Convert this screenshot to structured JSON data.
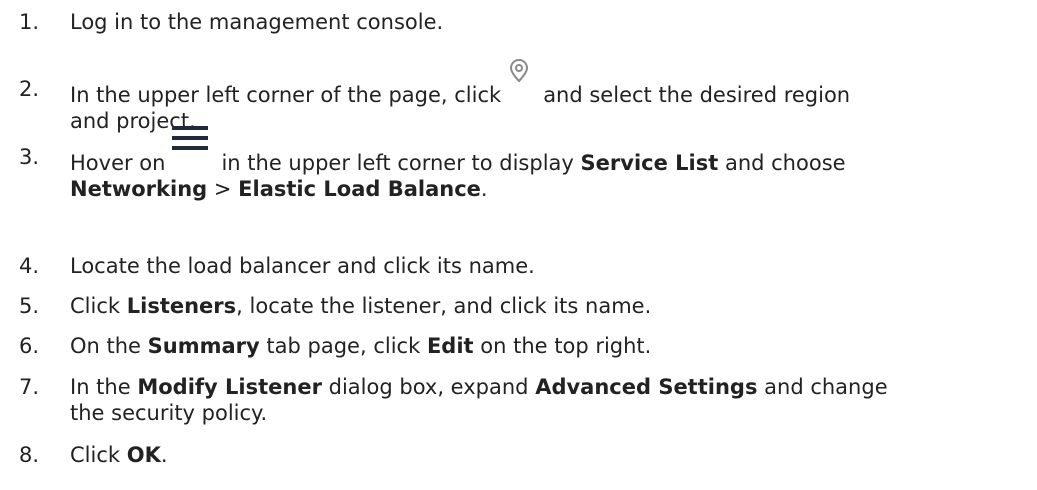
{
  "steps": [
    {
      "number": "1.",
      "text": "Log in to the management console."
    },
    {
      "number": "2.",
      "before_icon": "In the upper left corner of the page, click",
      "icon": "location-pin-icon",
      "after_icon": "and select the desired region",
      "continuation": "and project."
    },
    {
      "number": "3.",
      "before_icon": "Hover on",
      "icon": "hamburger-menu-icon",
      "after_icon": "in the upper left corner to display",
      "bold_1": "Service List",
      "after_bold_1": "and choose",
      "bold_2": "Networking",
      "separator": ">",
      "bold_3": "Elastic Load Balance",
      "end": "."
    },
    {
      "number": "4.",
      "text": "Locate the load balancer and click its name."
    },
    {
      "number": "5.",
      "before": "Click",
      "bold_1": "Listeners",
      "after": ", locate the listener, and click its name."
    },
    {
      "number": "6.",
      "before": "On the",
      "bold_1": "Summary",
      "middle": "tab page, click",
      "bold_2": "Edit",
      "after": "on the top right."
    },
    {
      "number": "7.",
      "before": "In the",
      "bold_1": "Modify Listener",
      "middle": "dialog box, expand",
      "bold_2": "Advanced Settings",
      "after": "and change",
      "continuation": "the security policy."
    },
    {
      "number": "8.",
      "before": "Click",
      "bold_1": "OK",
      "end": "."
    }
  ],
  "colors": {
    "text": "#222222",
    "icon_gray": "#8a8a8a",
    "icon_dark": "#1f2a3a"
  }
}
